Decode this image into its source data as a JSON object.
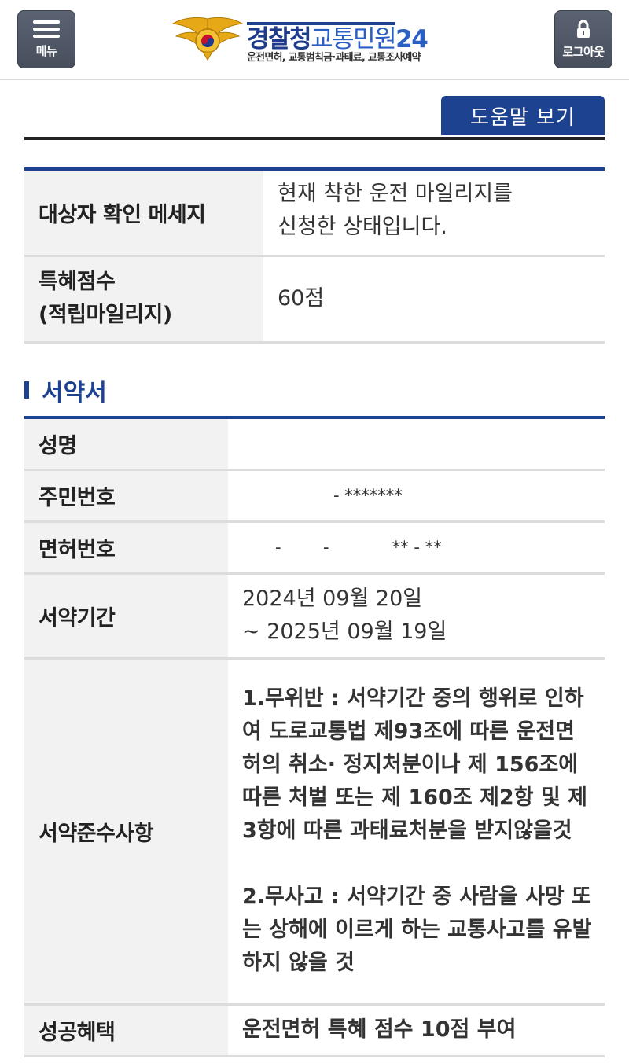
{
  "header": {
    "menu_label": "메뉴",
    "logout_label": "로그아웃",
    "logo_title_part1": "경찰청",
    "logo_title_part2": "교통민원",
    "logo_title_part3": "24",
    "logo_subtitle": "운전면허, 교통범칙금·과태료, 교통조사예약"
  },
  "help_button": "도움말 보기",
  "status_table": {
    "rows": [
      {
        "label": "대상자 확인 메세지",
        "value": "현재 착한 운전 마일리지를\n신청한 상태입니다."
      },
      {
        "label": "특혜점수\n(적립마일리지)",
        "value": "60점"
      }
    ]
  },
  "pledge": {
    "section_title": "서약서",
    "rows": [
      {
        "label": "성명",
        "value": ""
      },
      {
        "label": "주민번호",
        "value": "- *******"
      },
      {
        "label": "면허번호",
        "value": "-        -            ** - **"
      },
      {
        "label": "서약기간",
        "value": "2024년 09월 20일\n~ 2025년 09월 19일"
      },
      {
        "label": "서약준수사항",
        "value": "1.무위반 : 서약기간 중의 행위로 인하여 도로교통법 제93조에 따른 운전면허의 취소· 정지처분이나 제 156조에 따른 처벌 또는 제 160조 제2항 및 제3항에 따른 과태료처분을 받지않을것\n\n2.무사고 : 서약기간 중 사람을 사망 또는 상해에 이르게 하는 교통사고를 유발하지 않을 것"
      },
      {
        "label": "성공혜택",
        "value": "운전면허 특혜 점수 10점 부여"
      }
    ]
  },
  "colors": {
    "primary_blue": "#1d428f",
    "header_button_gray": "#505866",
    "label_bg": "#f2f2f2"
  }
}
